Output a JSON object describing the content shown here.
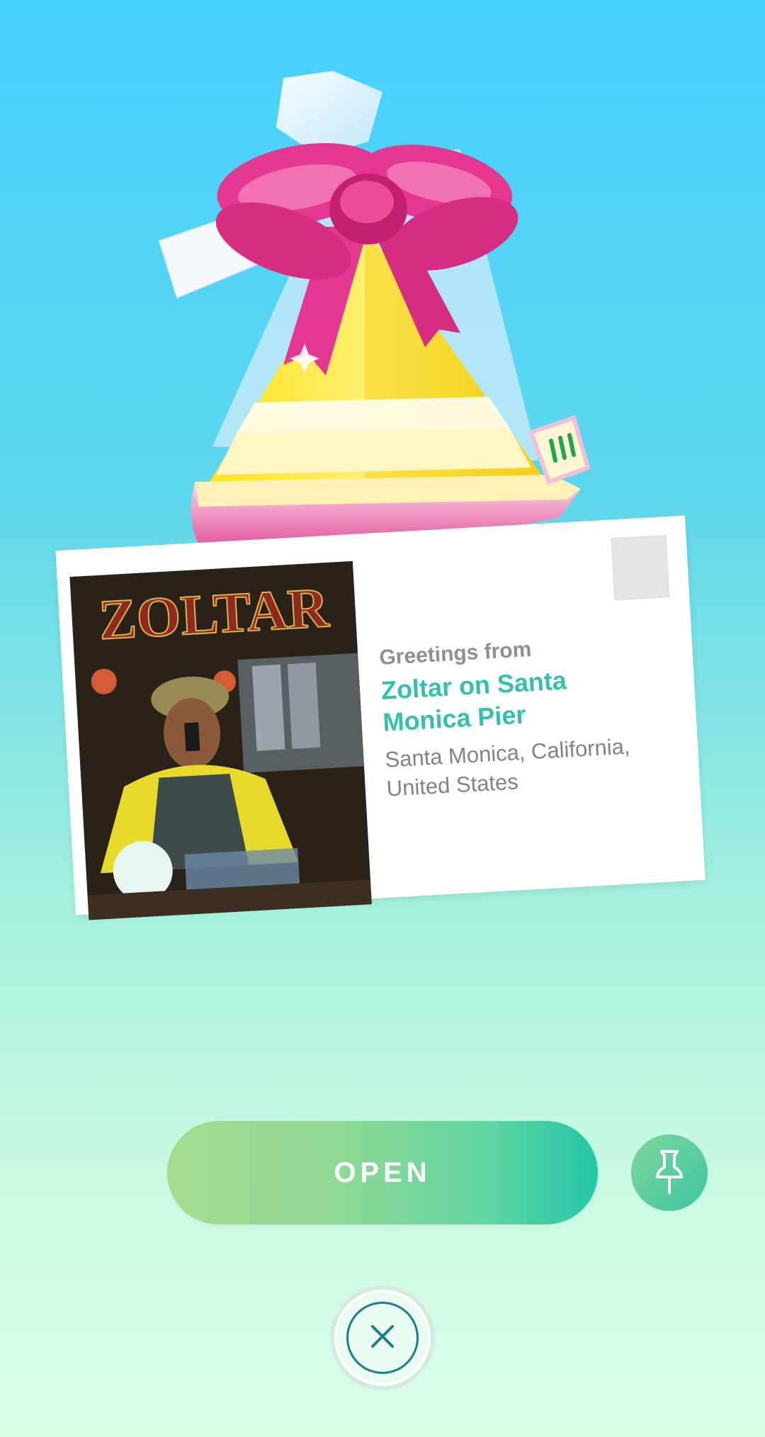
{
  "postcard": {
    "greeting": "Greetings from",
    "place_name": "Zoltar on Santa Monica Pier",
    "location": "Santa Monica, California, United States",
    "photo_sign_text": "ZOLTAR"
  },
  "actions": {
    "open_label": "OPEN"
  },
  "icons": {
    "pin": "pin-icon",
    "close": "close-icon"
  },
  "colors": {
    "place_name": "#33c0ae",
    "gift_ribbon": "#e4378f",
    "gift_body": "#ffe71f"
  }
}
